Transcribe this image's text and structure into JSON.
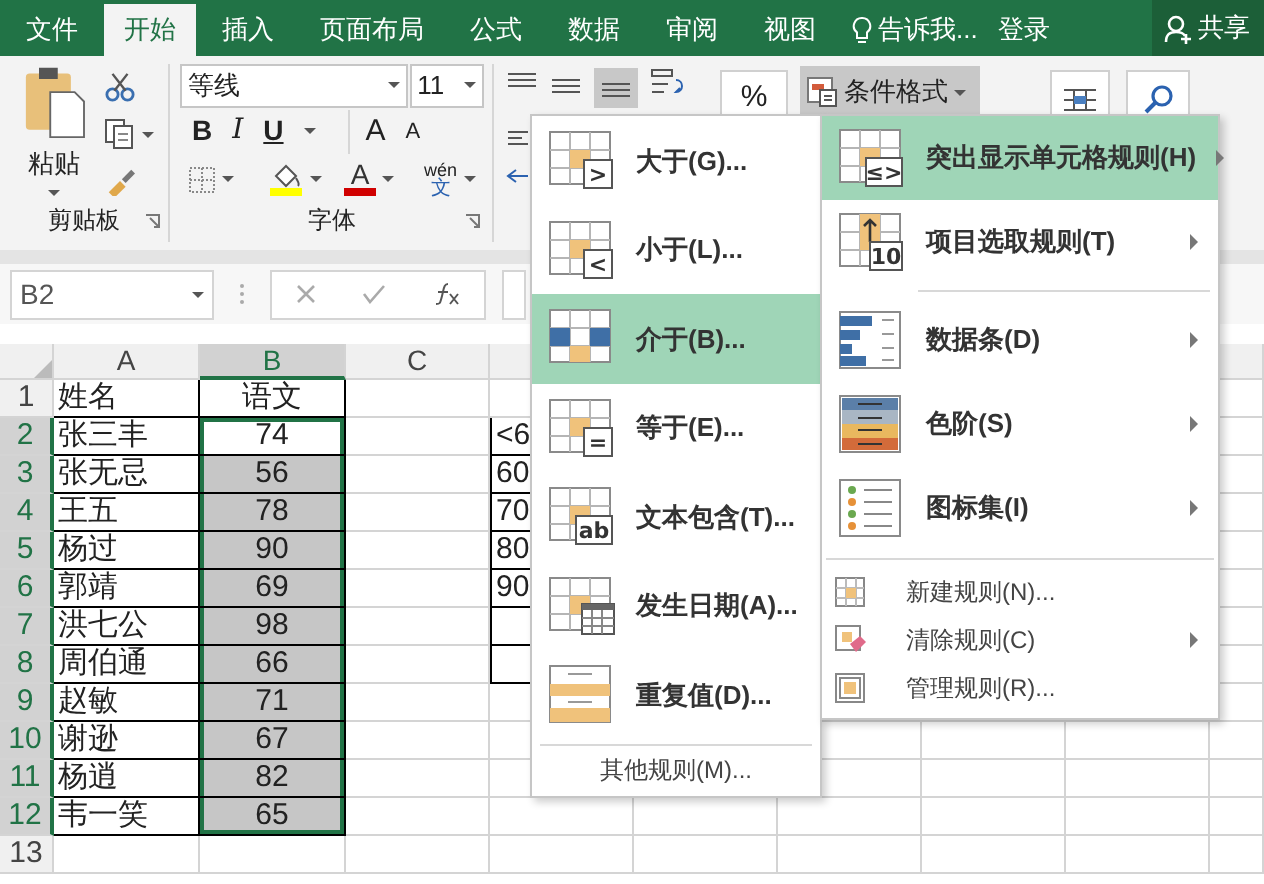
{
  "ribbon_tabs": [
    {
      "label": "文件",
      "selected": false
    },
    {
      "label": "开始",
      "selected": true
    },
    {
      "label": "插入",
      "selected": false
    },
    {
      "label": "页面布局",
      "selected": false
    },
    {
      "label": "公式",
      "selected": false
    },
    {
      "label": "数据",
      "selected": false
    },
    {
      "label": "审阅",
      "selected": false
    },
    {
      "label": "视图",
      "selected": false
    }
  ],
  "tell_me": "告诉我...",
  "sign_in": "登录",
  "share": "共享",
  "clipboard": {
    "paste": "粘贴",
    "group_label": "剪贴板"
  },
  "font": {
    "name": "等线",
    "size": "11",
    "bold": "B",
    "italic": "I",
    "underline": "U",
    "grow": "A",
    "shrink": "A",
    "font_color": "A",
    "phonetic_top": "wén",
    "phonetic_bottom": "文",
    "group_label": "字体"
  },
  "number": {
    "percent": "%"
  },
  "conditional_format": {
    "label": "条件格式",
    "expanded": true
  },
  "formula_bar": {
    "name_box": "B2"
  },
  "sheet": {
    "columns": [
      {
        "label": "A",
        "selected": false
      },
      {
        "label": "B",
        "selected": true
      },
      {
        "label": "C",
        "selected": false
      }
    ],
    "rows": [
      {
        "number": "1",
        "selected": false,
        "name": "姓名",
        "score": "语文"
      },
      {
        "number": "2",
        "selected": true,
        "active": true,
        "name": "张三丰",
        "score": "74",
        "col_d": "<6"
      },
      {
        "number": "3",
        "selected": true,
        "name": "张无忌",
        "score": "56",
        "col_d": "60"
      },
      {
        "number": "4",
        "selected": true,
        "name": "王五",
        "score": "78",
        "col_d": "70"
      },
      {
        "number": "5",
        "selected": true,
        "name": "杨过",
        "score": "90",
        "col_d": "80"
      },
      {
        "number": "6",
        "selected": true,
        "name": "郭靖",
        "score": "69",
        "col_d": "90"
      },
      {
        "number": "7",
        "selected": true,
        "name": "洪七公",
        "score": "98"
      },
      {
        "number": "8",
        "selected": true,
        "name": "周伯通",
        "score": "66"
      },
      {
        "number": "9",
        "selected": true,
        "name": "赵敏",
        "score": "71"
      },
      {
        "number": "10",
        "selected": true,
        "name": "谢逊",
        "score": "67"
      },
      {
        "number": "11",
        "selected": true,
        "name": "杨逍",
        "score": "82"
      },
      {
        "number": "12",
        "selected": true,
        "name": "韦一笑",
        "score": "65"
      },
      {
        "number": "13",
        "selected": false
      }
    ]
  },
  "highlight_menu": {
    "items": [
      {
        "kind": "compare",
        "label": "大于(G)...",
        "icon_label": ">",
        "selected": false
      },
      {
        "kind": "compare",
        "label": "小于(L)...",
        "icon_label": "<",
        "selected": false
      },
      {
        "kind": "between",
        "label": "介于(B)...",
        "selected": true
      },
      {
        "kind": "compare",
        "label": "等于(E)...",
        "icon_label": "=",
        "selected": false
      },
      {
        "kind": "compare",
        "label": "文本包含(T)...",
        "icon_label": "ab",
        "selected": false
      },
      {
        "kind": "date",
        "label": "发生日期(A)...",
        "selected": false
      },
      {
        "kind": "duplicate",
        "label": "重复值(D)...",
        "selected": false
      }
    ],
    "more": "其他规则(M)..."
  },
  "conditional_menu": {
    "sections": [
      [
        {
          "kind": "highlight",
          "label": "突出显示单元格规则(H)",
          "icon_label": "≤>",
          "submenu": true,
          "selected": true
        },
        {
          "kind": "top",
          "label": "项目选取规则(T)",
          "icon_label": "10",
          "submenu": true,
          "selected": false
        }
      ],
      [
        {
          "kind": "databar",
          "label": "数据条(D)",
          "submenu": true,
          "selected": false
        },
        {
          "kind": "colorscale",
          "label": "色阶(S)",
          "submenu": true,
          "selected": false
        },
        {
          "kind": "iconset",
          "label": "图标集(I)",
          "submenu": true,
          "selected": false
        }
      ],
      [
        {
          "kind": "new",
          "label": "新建规则(N)...",
          "submenu": false,
          "selected": false
        },
        {
          "kind": "clear",
          "label": "清除规则(C)",
          "submenu": true,
          "selected": false
        },
        {
          "kind": "manage",
          "label": "管理规则(R)...",
          "submenu": false,
          "selected": false
        }
      ]
    ]
  }
}
